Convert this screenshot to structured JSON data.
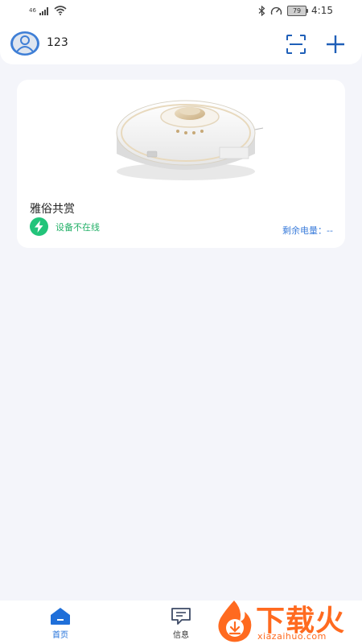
{
  "status_bar": {
    "signal_prefix": "46",
    "battery_level": "79",
    "time": "4:15"
  },
  "header": {
    "username": "123",
    "icons": [
      "avatar-icon",
      "scan-icon",
      "plus-icon"
    ]
  },
  "device": {
    "name": "雅俗共赏",
    "status": "设备不在线",
    "battery_label": "剩余电量：--"
  },
  "tabs": [
    {
      "label": "首页",
      "icon": "home-icon",
      "active": true
    },
    {
      "label": "信息",
      "icon": "message-icon",
      "active": false
    }
  ],
  "watermark": {
    "title": "下载火",
    "subtitle": "xiazaihuo.com"
  },
  "colors": {
    "accent": "#1f6fd9",
    "online_green": "#22c47a",
    "battery_text": "#3d7edb",
    "page_bg": "#f4f5fa",
    "watermark": "#ff6a1f"
  }
}
